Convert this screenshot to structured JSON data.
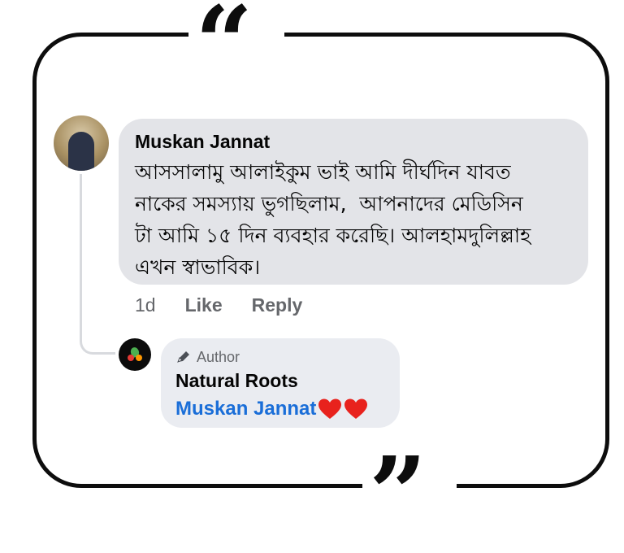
{
  "comment": {
    "author": "Muskan Jannat",
    "lines": [
      "আসসালামু আলাইকুম ভাই আমি দীর্ঘদিন যাবত",
      "নাকের সমস্যায় ভুগছিলাম,  আপনাদের মেডিসিন",
      "টা আমি ১৫ দিন ব্যবহার করেছি। আলহামদুলিল্লাহ",
      "এখন স্বাভাবিক।"
    ],
    "time": "1d",
    "like_label": "Like",
    "reply_label": "Reply"
  },
  "reply": {
    "badge_label": "Author",
    "author": "Natural Roots",
    "mention": "Muskan Jannat",
    "emoji": [
      "red-heart-icon",
      "red-heart-icon"
    ]
  },
  "decor": {
    "open_quote": "“",
    "close_quote": "”"
  },
  "colors": {
    "frame": "#0d0d0d",
    "bubble": "#e3e4e8",
    "mention": "#1a6ed8",
    "muted": "#65676b",
    "heart": "#e8221d"
  }
}
